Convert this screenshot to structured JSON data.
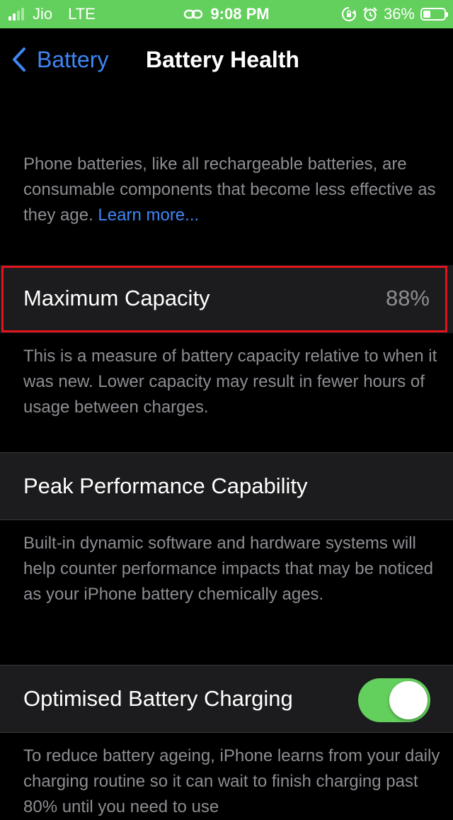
{
  "status_bar": {
    "carrier": "Jio",
    "network": "LTE",
    "time": "9:08 PM",
    "battery_percent": "36%",
    "battery_level": 0.36,
    "background_color": "#63cf5c",
    "icons": [
      "signal-icon",
      "link-icon",
      "rotation-lock-icon",
      "alarm-icon",
      "battery-icon"
    ]
  },
  "nav": {
    "back_label": "Battery",
    "title": "Battery Health",
    "accent_color": "#3f86f5"
  },
  "intro": {
    "text": "Phone batteries, like all rechargeable batteries, are consumable components that become less effective as they age.",
    "link": "Learn more..."
  },
  "max_capacity": {
    "label": "Maximum Capacity",
    "value": "88%",
    "description": "This is a measure of battery capacity relative to when it was new. Lower capacity may result in fewer hours of usage between charges."
  },
  "peak_performance": {
    "label": "Peak Performance Capability",
    "description": "Built-in dynamic software and hardware systems will help counter performance impacts that may be noticed as your iPhone battery chemically ages."
  },
  "optimised_charging": {
    "label": "Optimised Battery Charging",
    "enabled": true,
    "toggle_color": "#63cf5c",
    "description": "To reduce battery ageing, iPhone learns from your daily charging routine so it can wait to finish charging past 80% until you need to use"
  },
  "highlight_color": "#e0141d"
}
